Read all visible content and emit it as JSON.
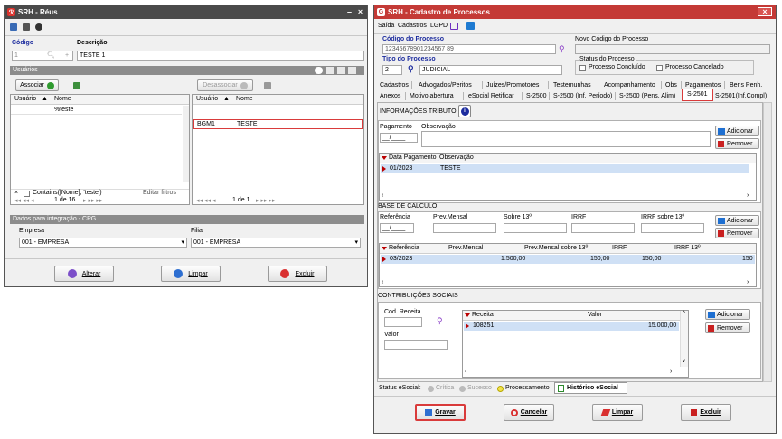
{
  "reus": {
    "title": "SRH - Réus",
    "codigo_label": "Código",
    "descricao_label": "Descrição",
    "codigo_value": "1",
    "descricao_value": "TESTE 1",
    "usuarios_header": "Usuários",
    "associar_label": "Associar",
    "desassociar_label": "Desassociar",
    "col_usuario": "Usuário",
    "col_nome": "Nome",
    "left_rows": [
      {
        "usuario": "",
        "nome": "%teste"
      }
    ],
    "right_rows": [
      {
        "usuario": "BGM1",
        "nome": "TESTE"
      }
    ],
    "filter_text": "Contains([Nome], 'teste')",
    "editar_filtros": "Editar filtros",
    "left_pager": "1 de 16",
    "right_pager": "1 de 1",
    "integracao_header": "Dados para integração - CPG",
    "empresa_label": "Empresa",
    "filial_label": "Filial",
    "empresa_value": "001 - EMPRESA",
    "filial_value": "001 - EMPRESA",
    "alterar_label": "Alterar",
    "limpar_label": "Limpar",
    "excluir_label": "Excluir"
  },
  "cadastro": {
    "title": "SRH - Cadastro de Processos",
    "menu": [
      "Saída",
      "Cadastros",
      "LGPD"
    ],
    "codigo_processo_label": "Código do Processo",
    "codigo_processo_value": "12345678901234567 89",
    "novo_codigo_label": "Novo Código do Processo",
    "tipo_processo_label": "Tipo do Processo",
    "tipo_code": "2",
    "tipo_value": "JUDICIAL",
    "status_label": "Status do Processo",
    "concluido_label": "Processo Concluído",
    "cancelado_label": "Processo Cancelado",
    "tabs_row1": [
      "Cadastros",
      "Advogados/Peritos",
      "Juízes/Promotores",
      "Testemunhas",
      "Acompanhamento",
      "Obs",
      "Pagamentos",
      "Bens Penh."
    ],
    "tabs_row2": [
      "Anexos",
      "Motivo abertura",
      "eSocial Retificar",
      "S-2500",
      "S-2500 (Inf. Período)",
      "S-2500 (Pens. Alim)",
      "S-2501",
      "S-2501(Inf.Compl)"
    ],
    "info_tributo": "INFORMAÇÕES TRIBUTO",
    "pagamento_label": "Pagamento",
    "observacao_label": "Observação",
    "pagamento_placeholder": "__/____",
    "adicionar_label": "Adicionar",
    "remover_label": "Remover",
    "trib_cols": [
      "Data Pagamento",
      "Observação"
    ],
    "trib_rows": [
      [
        "01/2023",
        "TESTE"
      ]
    ],
    "base_calculo": "BASE DE CALCULO",
    "base_labels": [
      "Referência",
      "Prev.Mensal",
      "Sobre 13º",
      "IRRF",
      "IRRF sobre 13º"
    ],
    "base_cols": [
      "Referência",
      "Prev.Mensal",
      "Prev.Mensal sobre 13º",
      "IRRF",
      "IRRF 13º"
    ],
    "base_rows": [
      [
        "03/2023",
        "1.500,00",
        "150,00",
        "150,00",
        "150"
      ]
    ],
    "contrib_sociais": "CONTRIBUIÇÕES SOCIAIS",
    "cod_receita_label": "Cod. Receita",
    "valor_label": "Valor",
    "contrib_cols": [
      "Receita",
      "Valor"
    ],
    "contrib_rows": [
      [
        "108251",
        "15.000,00"
      ]
    ],
    "status_esocial_label": "Status eSocial:",
    "status_items": [
      "Crítica",
      "Sucesso",
      "Processamento"
    ],
    "historico_label": "Histórico eSocial",
    "gravar_label": "Gravar",
    "cancelar_label": "Cancelar",
    "limpar_label": "Limpar",
    "excluir_label": "Excluir"
  }
}
